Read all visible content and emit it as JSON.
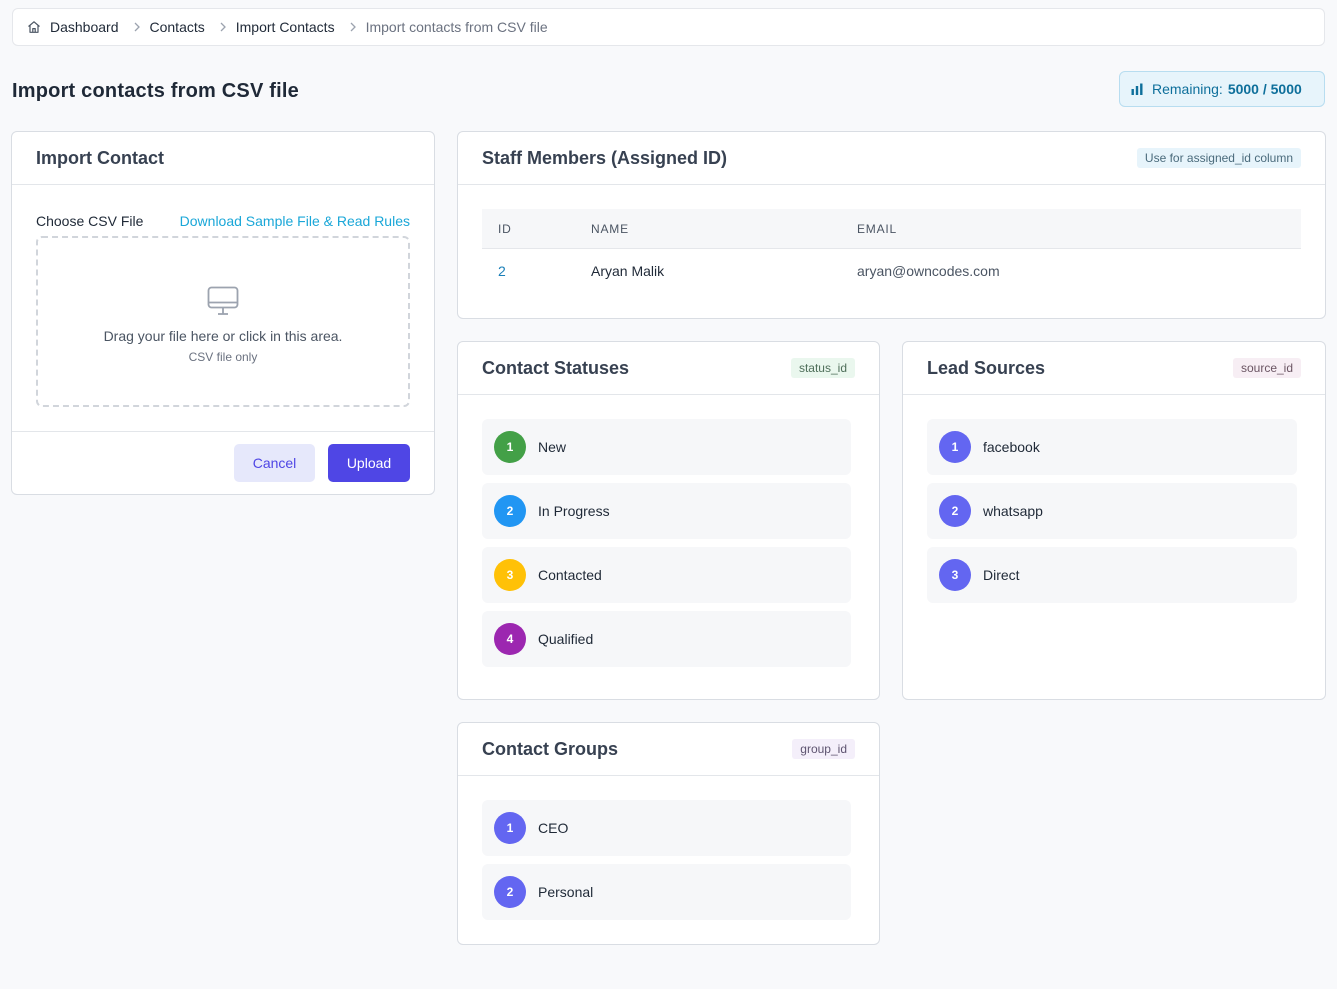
{
  "breadcrumb": {
    "items": [
      "Dashboard",
      "Contacts",
      "Import Contacts",
      "Import contacts from CSV file"
    ]
  },
  "page": {
    "title": "Import contacts from CSV file",
    "remaining_label": "Remaining:",
    "remaining_value": "5000 / 5000"
  },
  "import_card": {
    "title": "Import Contact",
    "choose_label": "Choose CSV File",
    "download_link": "Download Sample File & Read Rules",
    "drop_text": "Drag your file here or click in this area.",
    "drop_sub": "CSV file only",
    "cancel_label": "Cancel",
    "upload_label": "Upload"
  },
  "staff_card": {
    "title": "Staff Members (Assigned ID)",
    "chip": "Use for assigned_id column",
    "columns": [
      "ID",
      "NAME",
      "EMAIL"
    ],
    "rows": [
      {
        "id": "2",
        "name": "Aryan Malik",
        "email": "aryan@owncodes.com"
      }
    ]
  },
  "statuses_card": {
    "title": "Contact Statuses",
    "chip": "status_id",
    "items": [
      {
        "num": "1",
        "label": "New",
        "color": "#43a047"
      },
      {
        "num": "2",
        "label": "In Progress",
        "color": "#2196f3"
      },
      {
        "num": "3",
        "label": "Contacted",
        "color": "#ffc107"
      },
      {
        "num": "4",
        "label": "Qualified",
        "color": "#9c27b0"
      }
    ]
  },
  "sources_card": {
    "title": "Lead Sources",
    "chip": "source_id",
    "items": [
      {
        "num": "1",
        "label": "facebook",
        "color": "#6366f1"
      },
      {
        "num": "2",
        "label": "whatsapp",
        "color": "#6366f1"
      },
      {
        "num": "3",
        "label": "Direct",
        "color": "#6366f1"
      }
    ]
  },
  "groups_card": {
    "title": "Contact Groups",
    "chip": "group_id",
    "items": [
      {
        "num": "1",
        "label": "CEO",
        "color": "#6366f1"
      },
      {
        "num": "2",
        "label": "Personal",
        "color": "#6366f1"
      }
    ]
  },
  "colors": {
    "primary": "#4f46e5",
    "link": "#1aa7d8"
  }
}
